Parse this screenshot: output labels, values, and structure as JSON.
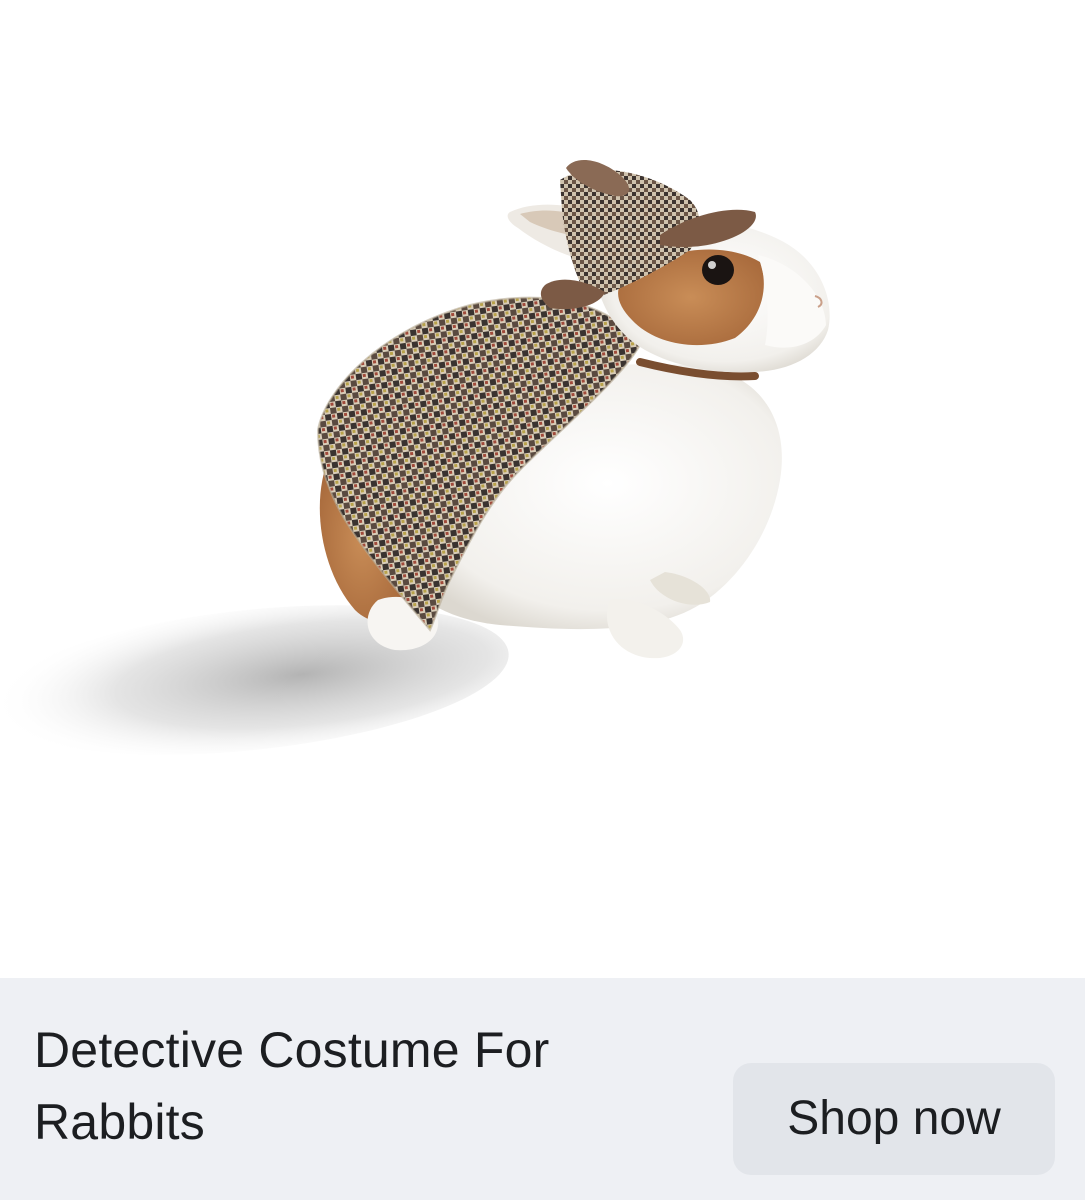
{
  "ad": {
    "image_subject": "rabbit-in-detective-costume",
    "title": "Detective Costume For Rabbits",
    "cta_label": "Shop now"
  },
  "colors": {
    "footer_background": "#eef0f4",
    "button_background": "#e2e5ea",
    "text": "#1c1e21"
  }
}
